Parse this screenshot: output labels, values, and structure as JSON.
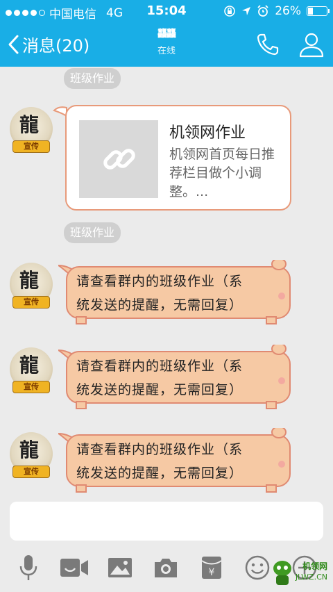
{
  "status_bar": {
    "carrier": "中国电信",
    "network": "4G",
    "time": "15:04",
    "battery": "26%",
    "battery_level": 0.26
  },
  "nav": {
    "back_label": "消息(20)",
    "title_logo": "龘龘",
    "subtitle": "在线"
  },
  "messages": [
    {
      "type": "tag",
      "text": "班级作业"
    },
    {
      "type": "link",
      "title": "机领网作业",
      "description": "机领网首页每日推荐栏目做个小调整。..."
    },
    {
      "type": "tag",
      "text": "班级作业"
    },
    {
      "type": "text",
      "line1": "请查看群内的班级作业（系",
      "line2": "统发送的提醒，无需回复）"
    },
    {
      "type": "text",
      "line1": "请查看群内的班级作业（系",
      "line2": "统发送的提醒，无需回复）"
    },
    {
      "type": "text",
      "line1": "请查看群内的班级作业（系",
      "line2": "统发送的提醒，无需回复）"
    }
  ],
  "avatar": {
    "char": "龍",
    "badge": "宣传"
  },
  "input": {
    "placeholder": ""
  },
  "toolbar": [
    "microphone-icon",
    "video-icon",
    "image-icon",
    "camera-icon",
    "red-packet-icon",
    "emoji-icon",
    "plus-icon"
  ],
  "watermark": {
    "text": "机领网",
    "url": "JLWZ.CN"
  },
  "colors": {
    "nav_bg": "#19aee6",
    "bubble_fill": "#f6c9a4",
    "bubble_border": "#e08a72",
    "tag_bg": "#cfcfcf"
  }
}
